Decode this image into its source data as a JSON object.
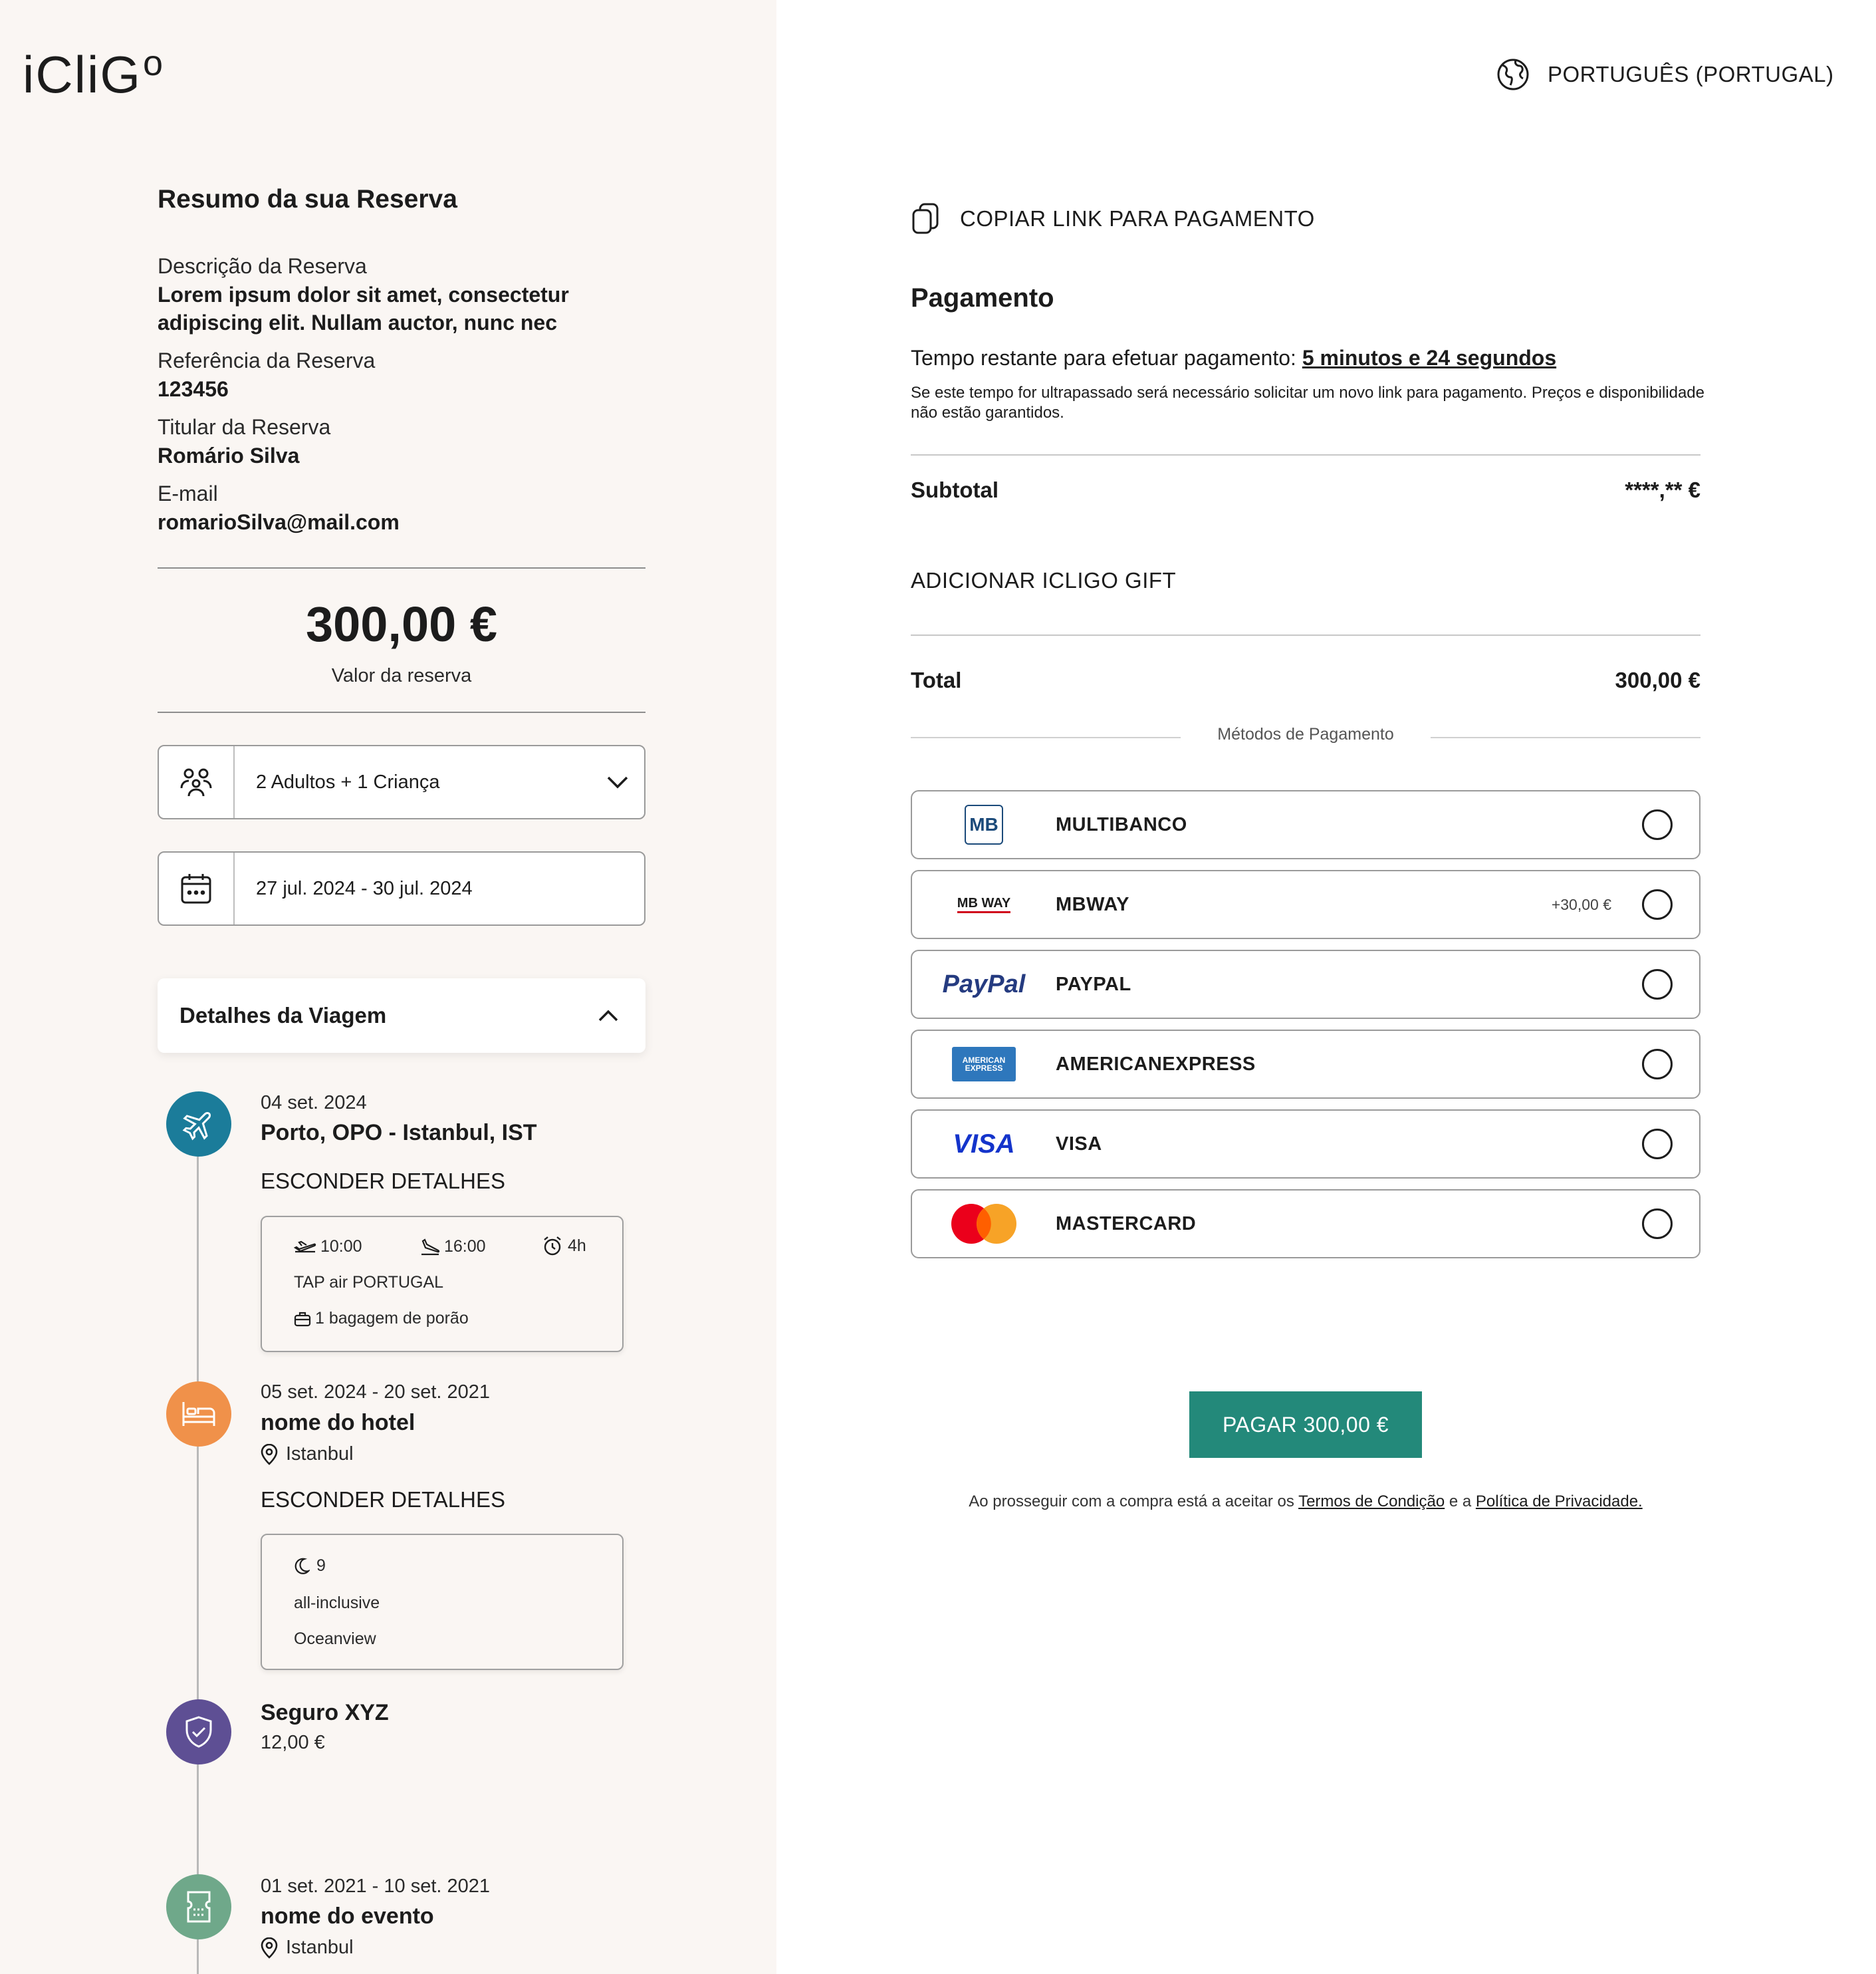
{
  "brand": {
    "logo_text": "iCliG",
    "logo_sup": "o"
  },
  "language": {
    "label": "PORTUGUÊS (PORTUGAL)"
  },
  "summary": {
    "title": "Resumo da sua Reserva",
    "description_label": "Descrição da Reserva",
    "description_value_1": "Lorem ipsum dolor sit amet, consectetur",
    "description_value_2": "adipiscing elit. Nullam auctor, nunc nec",
    "reference_label": "Referência da Reserva",
    "reference_value": "123456",
    "holder_label": "Titular da Reserva",
    "holder_value": "Romário Silva",
    "email_label": "E-mail",
    "email_value": "romarioSilva@mail.com",
    "price": "300,00 €",
    "price_label": "Valor da reserva",
    "guests": "2 Adultos + 1 Criança",
    "dates": "27 jul. 2024 - 30 jul. 2024",
    "details_title": "Detalhes da Viagem"
  },
  "timeline": {
    "flight": {
      "date": "04 set. 2024",
      "route": "Porto, OPO - Istanbul, IST",
      "toggle": "ESCONDER DETALHES",
      "depart": "10:00",
      "arrive": "16:00",
      "duration": "4h",
      "airline": "TAP air PORTUGAL",
      "baggage": "1 bagagem de porão"
    },
    "hotel": {
      "dates": "05 set. 2024 - 20 set. 2021",
      "name": "nome do hotel",
      "location": "Istanbul",
      "toggle": "ESCONDER DETALHES",
      "nights": "9",
      "board": "all-inclusive",
      "room": "Oceanview"
    },
    "insurance": {
      "name": "Seguro XYZ",
      "price": "12,00 €"
    },
    "event": {
      "dates": "01 set. 2021 - 10 set. 2021",
      "name": "nome do evento",
      "location": "Istanbul"
    }
  },
  "payment": {
    "copy_link": "COPIAR LINK PARA PAGAMENTO",
    "title": "Pagamento",
    "time_label": "Tempo restante para efetuar pagamento: ",
    "time_value": "5 minutos e 24 segundos",
    "note": "Se este tempo for ultrapassado será necessário solicitar um novo link para pagamento. Preços e disponibilidade não estão garantidos.",
    "subtotal_label": "Subtotal",
    "subtotal_value": "****,** €",
    "gift_label": "ADICIONAR ICLIGO GIFT",
    "total_label": "Total",
    "total_value": "300,00 €",
    "methods_label": "Métodos de Pagamento",
    "methods": [
      {
        "name": "MULTIBANCO",
        "fee": "",
        "logo": "MB"
      },
      {
        "name": "MBWAY",
        "fee": "+30,00 €",
        "logo": "MB WAY"
      },
      {
        "name": "PAYPAL",
        "fee": "",
        "logo": "PayPal"
      },
      {
        "name": "AMERICANEXPRESS",
        "fee": "",
        "logo": "AMERICAN EXPRESS"
      },
      {
        "name": "VISA",
        "fee": "",
        "logo": "VISA"
      },
      {
        "name": "MASTERCARD",
        "fee": "",
        "logo": "mastercard-icon"
      }
    ],
    "pay_button": "PAGAR 300,00 €",
    "terms_prefix": "Ao prosseguir com a compra está a aceitar os ",
    "terms_link": "Termos de Condição",
    "terms_mid": " e a ",
    "privacy_link": "Política de Privacidade."
  },
  "colors": {
    "accent": "#23897a",
    "flight": "#1b7c9a",
    "hotel": "#f0914a",
    "insurance": "#5e4f94",
    "event": "#6fa88a"
  }
}
